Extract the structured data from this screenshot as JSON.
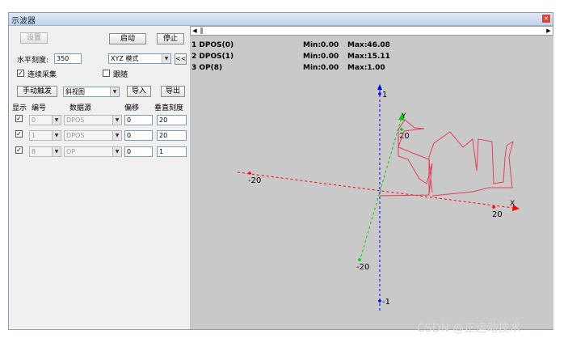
{
  "window": {
    "title": "示波器",
    "close_glyph": "×"
  },
  "controls": {
    "settings_label": "设置",
    "start_label": "启动",
    "stop_label": "停止",
    "h_scale_label": "水平刻度:",
    "h_scale_value": "350",
    "mode_value": "XYZ 模式",
    "collapse_label": "<<",
    "continuous_label": "连续采集",
    "continuous_checked": "✓",
    "follow_label": "跟随",
    "manual_trigger_label": "手动触发",
    "view_value": "斜视图",
    "import_label": "导入",
    "export_label": "导出"
  },
  "table": {
    "headers": {
      "show": "显示",
      "num": "编号",
      "src": "数据源",
      "offset": "偏移",
      "vscale": "垂直刻度"
    },
    "rows": [
      {
        "checked": "✓",
        "num": "0",
        "src": "DPOS",
        "offset": "0",
        "vscale": "20"
      },
      {
        "checked": "✓",
        "num": "1",
        "src": "DPOS",
        "offset": "0",
        "vscale": "20"
      },
      {
        "checked": "✓",
        "num": "8",
        "src": "OP",
        "offset": "0",
        "vscale": "1"
      }
    ]
  },
  "scrollbar": {
    "left_arrow": "◀",
    "right_arrow": "▶"
  },
  "series_info": [
    {
      "name": "1 DPOS(0)",
      "min": "Min:0.00",
      "max": "Max:46.08"
    },
    {
      "name": "2 DPOS(1)",
      "min": "Min:0.00",
      "max": "Max:15.11"
    },
    {
      "name": "3 OP(8)",
      "min": "Min:0.00",
      "max": "Max:1.00"
    }
  ],
  "axes": {
    "x_name": "X",
    "y_name": "Y",
    "x_neg": "-20",
    "x_pos": "20",
    "y_neg": "-20",
    "y_pos": "20",
    "z_neg": "-1",
    "z_pos": "1",
    "colors": {
      "x": "#ff0000",
      "y": "#00cc00",
      "z": "#0000ff",
      "trace": "#e0405a"
    }
  },
  "watermark": "CSDN @正运动技术"
}
